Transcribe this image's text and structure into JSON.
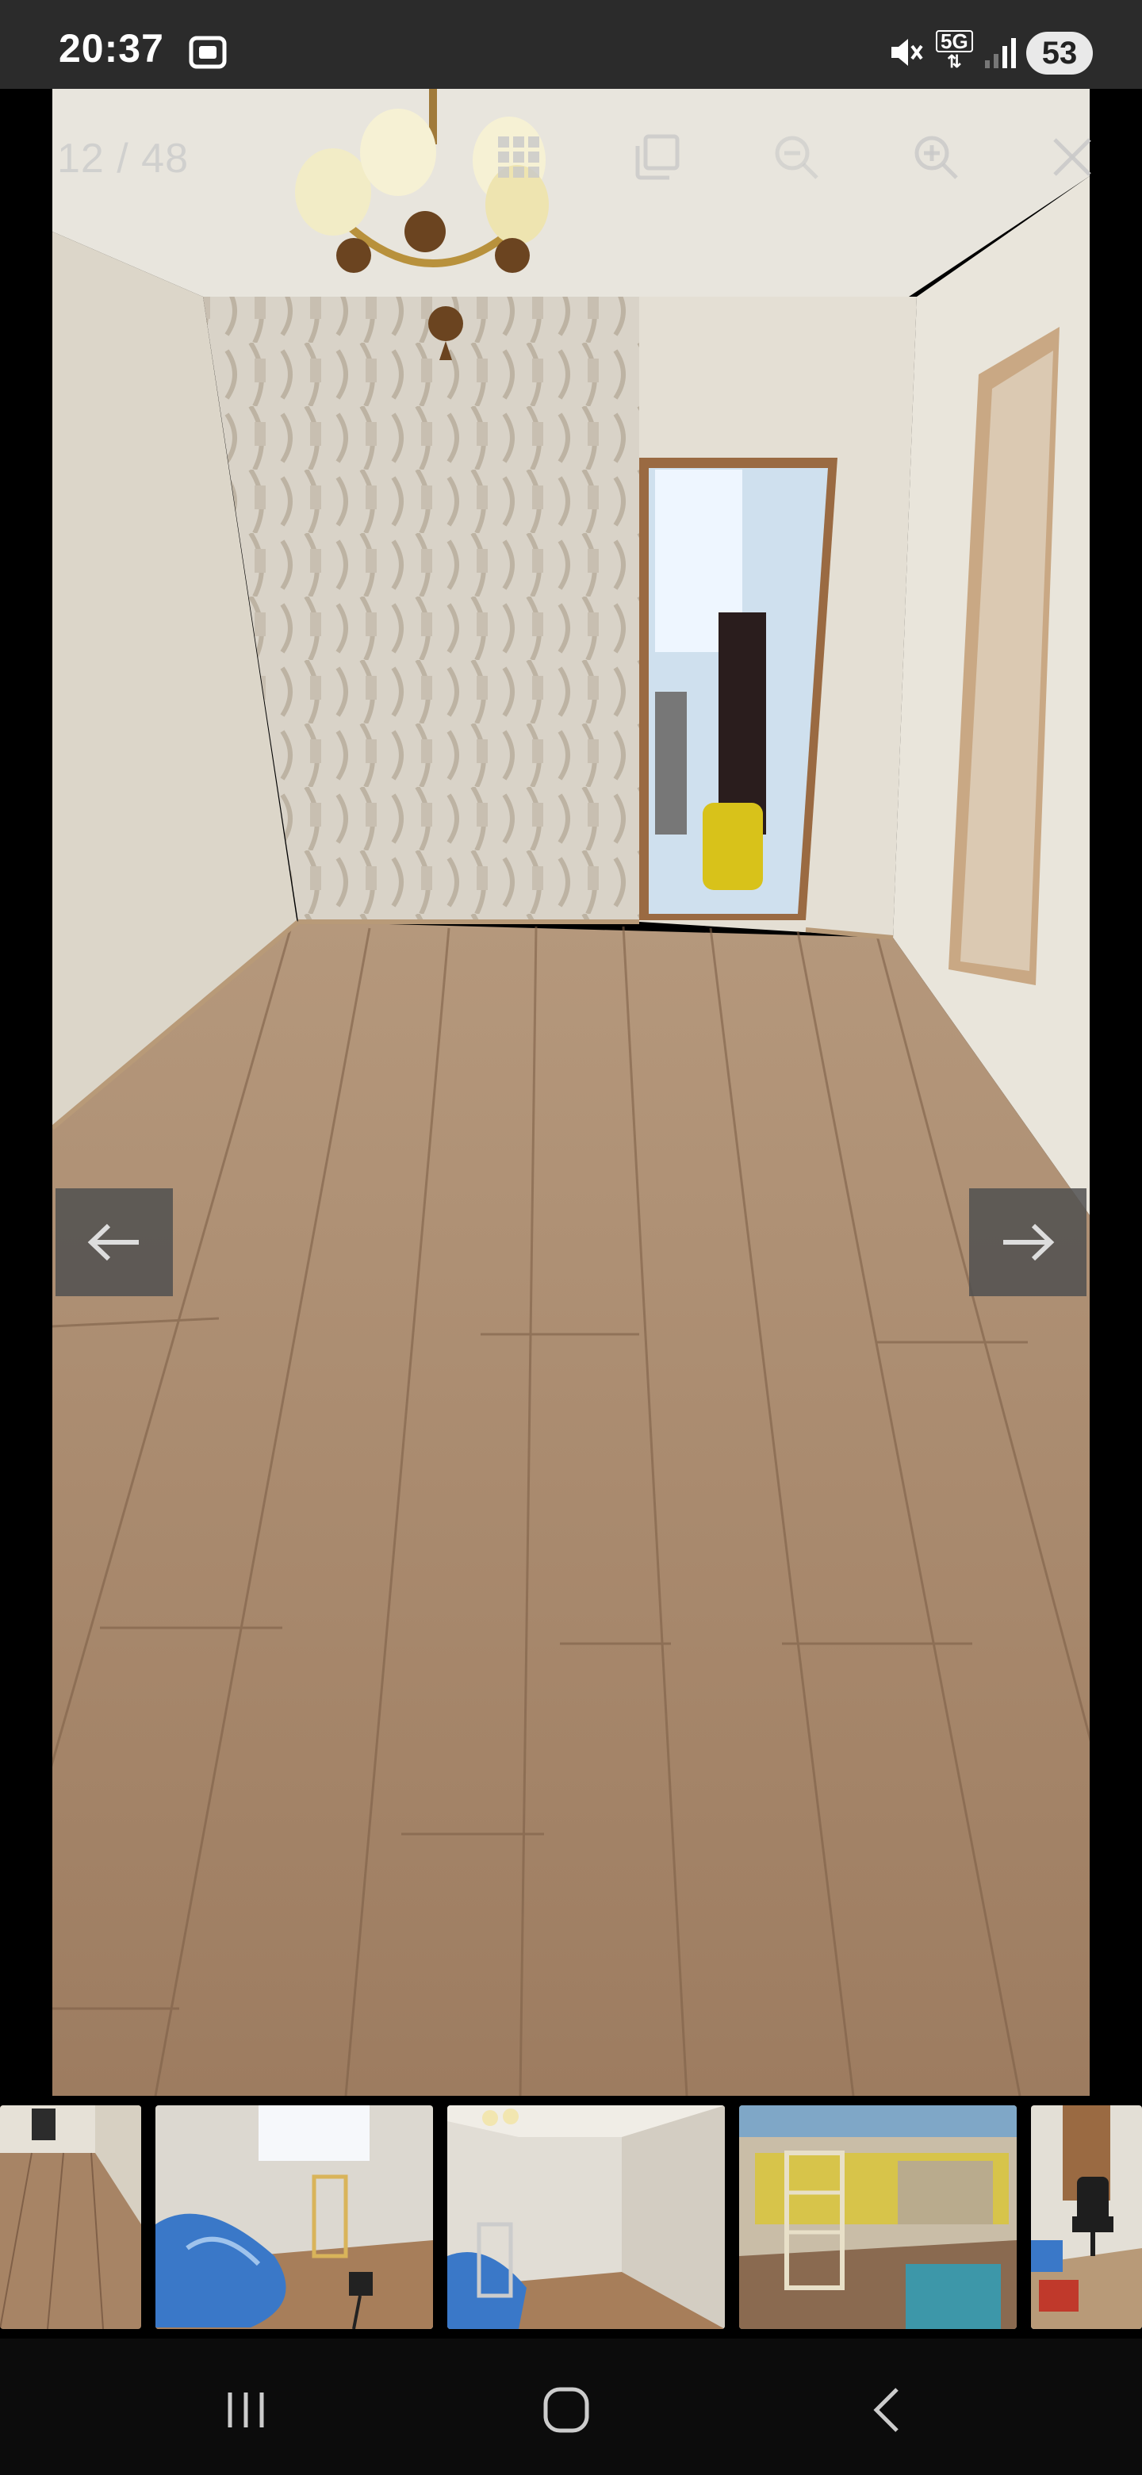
{
  "status_bar": {
    "time": "20:37",
    "network": "5G",
    "battery": "53",
    "icons": [
      "screenshot-icon",
      "mute-icon",
      "network-5g-icon",
      "signal-icon",
      "battery-icon"
    ]
  },
  "viewer": {
    "counter": "12 / 48",
    "toolbar": [
      "grid-icon",
      "copy-icon",
      "zoom-out-icon",
      "zoom-in-icon",
      "close-icon"
    ],
    "prev_icon": "arrow-left-icon",
    "next_icon": "arrow-right-icon"
  },
  "thumbnails": [
    {
      "name": "thumb-hallway-floor"
    },
    {
      "name": "thumb-room-covered-furniture"
    },
    {
      "name": "thumb-room-window-ladder"
    },
    {
      "name": "thumb-stripped-wall"
    },
    {
      "name": "thumb-office-chair"
    }
  ],
  "system_nav": [
    "recents-icon",
    "home-icon",
    "back-icon"
  ],
  "colors": {
    "status_bg": "#2b2b2b",
    "floor": "#a8876a",
    "wall": "#e2ddd2",
    "nav_button_bg": "#505050"
  }
}
